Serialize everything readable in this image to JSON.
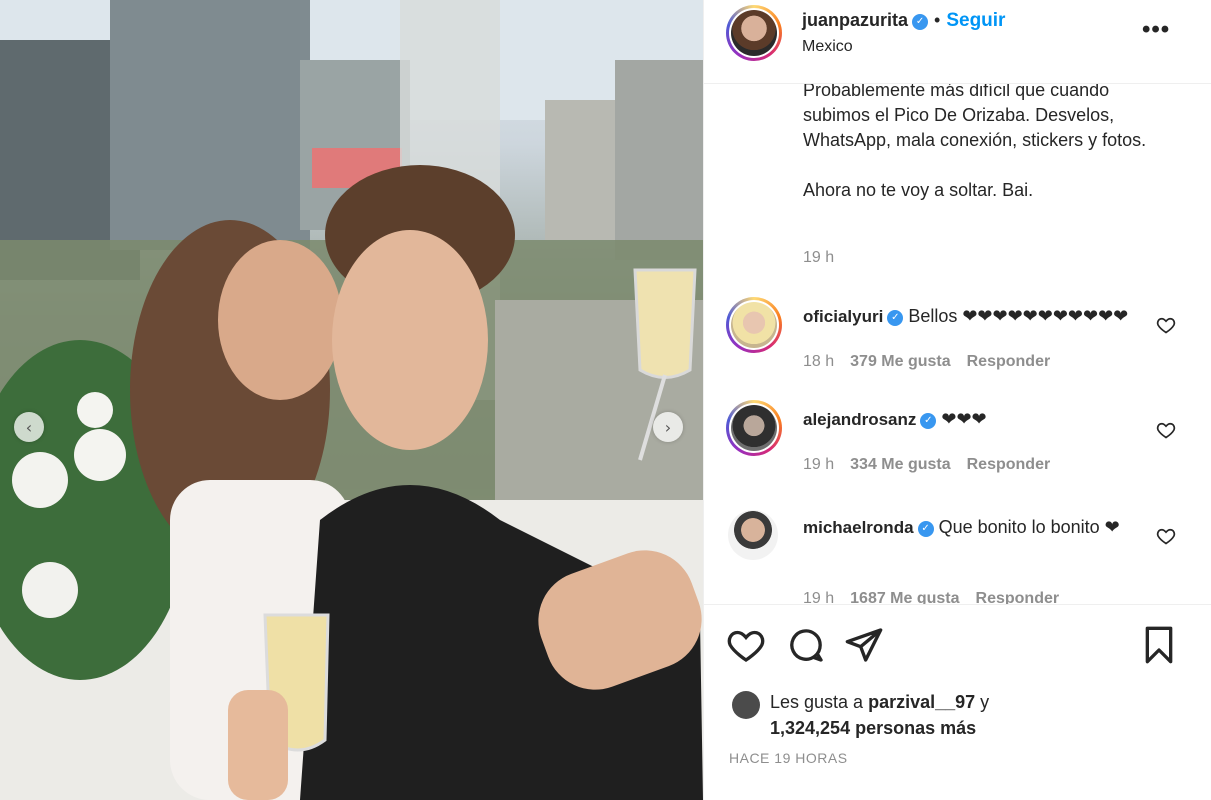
{
  "post": {
    "username": "juanpazurita",
    "verified_mark": "✓",
    "dot": "•",
    "follow_label": "Seguir",
    "location": "Mexico",
    "more_label": "•••"
  },
  "carousel": {
    "prev_icon": "chevron-left-icon",
    "next_icon": "chevron-right-icon",
    "prev_glyph": "‹",
    "next_glyph": "›"
  },
  "caption": {
    "line1": "Probablemente más difícil que cuando subimos el Pico De Orizaba. Desvelos, WhatsApp, mala conexión, stickers y fotos.",
    "line2": "Ahora no te voy a soltar. Bai.",
    "time": "19 h"
  },
  "comments": [
    {
      "username": "oficialyuri",
      "text": "Bellos ❤︎❤︎❤︎❤︎❤︎❤︎❤︎❤︎❤︎❤︎❤",
      "time": "18 h",
      "likes": "379 Me gusta",
      "reply": "Responder"
    },
    {
      "username": "alejandrosanz",
      "text": "❤︎❤︎❤︎",
      "time": "19 h",
      "likes": "334 Me gusta",
      "reply": "Responder"
    },
    {
      "username": "michaelronda",
      "text": "Que bonito lo bonito ❤",
      "time": "19 h",
      "likes": "1687 Me gusta",
      "reply": "Responder"
    }
  ],
  "likes": {
    "line1_prefix": "Les gusta a ",
    "user": "parzival__97",
    "line1_suffix": " y",
    "line2": "1,324,254 personas más"
  },
  "timestamp": "HACE 19 HORAS",
  "colors": {
    "link": "#0095f6",
    "verified": "#3897f0",
    "muted": "#8e8e8e",
    "text": "#262626"
  }
}
